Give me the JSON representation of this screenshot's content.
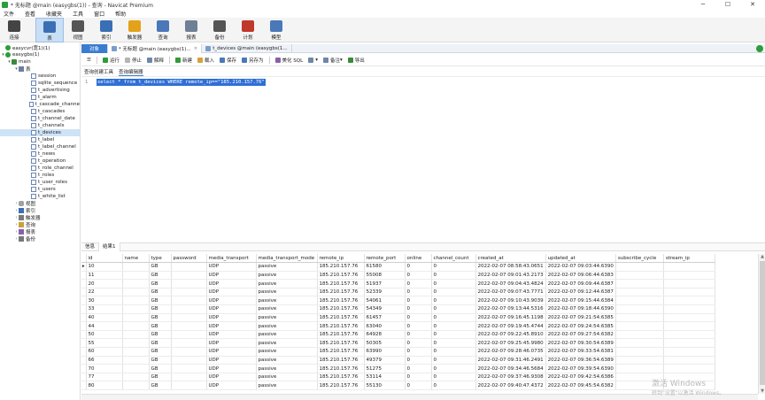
{
  "window": {
    "title": "* 无标题 @main (easygbs(1)) - 查询 - Navicat Premium",
    "controls": [
      "─",
      "☐",
      "✕"
    ]
  },
  "menu": [
    "文件",
    "查看",
    "收藏夹",
    "工具",
    "窗口",
    "帮助"
  ],
  "toolbar": [
    {
      "label": "连接",
      "icon": "plug-icon",
      "color": "#444444"
    },
    {
      "label": "表",
      "icon": "table-icon",
      "color": "#3a6fb5",
      "active": true
    },
    {
      "label": "视图",
      "icon": "glasses-icon",
      "color": "#555555"
    },
    {
      "label": "索引",
      "icon": "function-icon",
      "color": "#3a6fb5"
    },
    {
      "label": "触发器",
      "icon": "lightning-icon",
      "color": "#e3a21a"
    },
    {
      "label": "查询",
      "icon": "query-icon",
      "color": "#4a78b8"
    },
    {
      "label": "报表",
      "icon": "report-icon",
      "color": "#6f7f96"
    },
    {
      "label": "备份",
      "icon": "backup-icon",
      "color": "#555555"
    },
    {
      "label": "计划",
      "icon": "calendar-icon",
      "color": "#c0392b"
    },
    {
      "label": "模型",
      "icon": "model-icon",
      "color": "#4a78b8"
    }
  ],
  "tree": {
    "connections": [
      {
        "label": "easycvr(宽1)(1)",
        "icon": "connection-icon"
      },
      {
        "label": "easygbs(1)",
        "icon": "connection-icon"
      }
    ],
    "db": "main",
    "tables_folder": "表",
    "tables": [
      "session",
      "sqlite_sequence",
      "t_advertising",
      "t_alarm",
      "t_cascade_channe",
      "t_cascades",
      "t_channel_date",
      "t_channels",
      "t_devices",
      "t_label",
      "t_label_channel",
      "t_news",
      "t_operation",
      "t_role_channel",
      "t_roles",
      "t_user_roles",
      "t_users",
      "t_white_list"
    ],
    "selected_table": "t_devices",
    "other_folders": [
      {
        "label": "视图",
        "icon": "view-icon"
      },
      {
        "label": "索引",
        "icon": "function-icon"
      },
      {
        "label": "触发器",
        "icon": "trigger-icon"
      },
      {
        "label": "查询",
        "icon": "query-icon"
      },
      {
        "label": "报表",
        "icon": "report-icon"
      },
      {
        "label": "备份",
        "icon": "backup-icon"
      }
    ]
  },
  "tabs": {
    "object": "对象",
    "query_tab": "* 无标题 @main (easygbs(1)...",
    "devices_tab": "t_devices @main (easygbs(1..."
  },
  "query_toolbar": [
    "运行",
    "停止",
    "解释",
    "新建",
    "载入",
    "保存",
    "另存为",
    "美化 SQL",
    "",
    "备注",
    "导出"
  ],
  "subtabs": [
    "查询创建工具",
    "查询编辑器"
  ],
  "editor": {
    "line": "1",
    "sql": "select * from t_devices WHERE remote_ip==\"185.210.157.76\""
  },
  "result_tabs": [
    "信息",
    "结果1"
  ],
  "grid": {
    "columns": [
      "id",
      "name",
      "type",
      "password",
      "media_transport",
      "media_transport_mode",
      "remote_ip",
      "remote_port",
      "online",
      "channel_count",
      "created_at",
      "updated_at",
      "subscribe_cycle",
      "stream_ip"
    ],
    "rows": [
      [
        "10",
        "",
        "GB",
        "",
        "UDP",
        "passive",
        "185.210.157.76",
        "61580",
        "0",
        "0",
        "2022-02-07 08:58:43.0651",
        "2022-02-07 09:03:44.6390",
        "",
        ""
      ],
      [
        "11",
        "",
        "GB",
        "",
        "UDP",
        "passive",
        "185.210.157.76",
        "55008",
        "0",
        "0",
        "2022-02-07 09:01:43.2173",
        "2022-02-07 09:06:44.6383",
        "",
        ""
      ],
      [
        "20",
        "",
        "GB",
        "",
        "UDP",
        "passive",
        "185.210.157.76",
        "51937",
        "0",
        "0",
        "2022-02-07 09:04:43.4824",
        "2022-02-07 09:09:44.6387",
        "",
        ""
      ],
      [
        "22",
        "",
        "GB",
        "",
        "UDP",
        "passive",
        "185.210.157.76",
        "52339",
        "0",
        "0",
        "2022-02-07 09:07:43.7771",
        "2022-02-07 09:12:44.6387",
        "",
        ""
      ],
      [
        "30",
        "",
        "GB",
        "",
        "UDP",
        "passive",
        "185.210.157.76",
        "54061",
        "0",
        "0",
        "2022-02-07 09:10:43.9039",
        "2022-02-07 09:15:44.6384",
        "",
        ""
      ],
      [
        "33",
        "",
        "GB",
        "",
        "UDP",
        "passive",
        "185.210.157.76",
        "54349",
        "0",
        "0",
        "2022-02-07 09:13:44.5316",
        "2022-02-07 09:18:44.6390",
        "",
        ""
      ],
      [
        "40",
        "",
        "GB",
        "",
        "UDP",
        "passive",
        "185.210.157.76",
        "61457",
        "0",
        "0",
        "2022-02-07 09:16:45.1198",
        "2022-02-07 09:21:54.6385",
        "",
        ""
      ],
      [
        "44",
        "",
        "GB",
        "",
        "UDP",
        "passive",
        "185.210.157.76",
        "63040",
        "0",
        "0",
        "2022-02-07 09:19:45.4744",
        "2022-02-07 09:24:54.6385",
        "",
        ""
      ],
      [
        "50",
        "",
        "GB",
        "",
        "UDP",
        "passive",
        "185.210.157.76",
        "64928",
        "0",
        "0",
        "2022-02-07 09:22:45.8910",
        "2022-02-07 09:27:54.6382",
        "",
        ""
      ],
      [
        "55",
        "",
        "GB",
        "",
        "UDP",
        "passive",
        "185.210.157.76",
        "50305",
        "0",
        "0",
        "2022-02-07 09:25:45.9980",
        "2022-02-07 09:30:54.6389",
        "",
        ""
      ],
      [
        "60",
        "",
        "GB",
        "",
        "UDP",
        "passive",
        "185.210.157.76",
        "63990",
        "0",
        "0",
        "2022-02-07 09:28:46.0735",
        "2022-02-07 09:33:54.6381",
        "",
        ""
      ],
      [
        "66",
        "",
        "GB",
        "",
        "UDP",
        "passive",
        "185.210.157.76",
        "49379",
        "0",
        "0",
        "2022-02-07 09:31:46.2491",
        "2022-02-07 09:36:54.6389",
        "",
        ""
      ],
      [
        "70",
        "",
        "GB",
        "",
        "UDP",
        "passive",
        "185.210.157.76",
        "51275",
        "0",
        "0",
        "2022-02-07 09:34:46.5684",
        "2022-02-07 09:39:54.6390",
        "",
        ""
      ],
      [
        "77",
        "",
        "GB",
        "",
        "UDP",
        "passive",
        "185.210.157.76",
        "53114",
        "0",
        "0",
        "2022-02-07 09:37:46.9308",
        "2022-02-07 09:42:54.6386",
        "",
        ""
      ],
      [
        "80",
        "",
        "GB",
        "",
        "UDP",
        "passive",
        "185.210.157.76",
        "55130",
        "0",
        "0",
        "2022-02-07 09:40:47.4372",
        "2022-02-07 09:45:54.6382",
        "",
        ""
      ]
    ]
  },
  "watermark": {
    "line1": "激活 Windows",
    "line2": "转到\"设置\"以激活 Windows。"
  },
  "accent": "#3a7cd1",
  "selection_color": "#2f6fd6"
}
